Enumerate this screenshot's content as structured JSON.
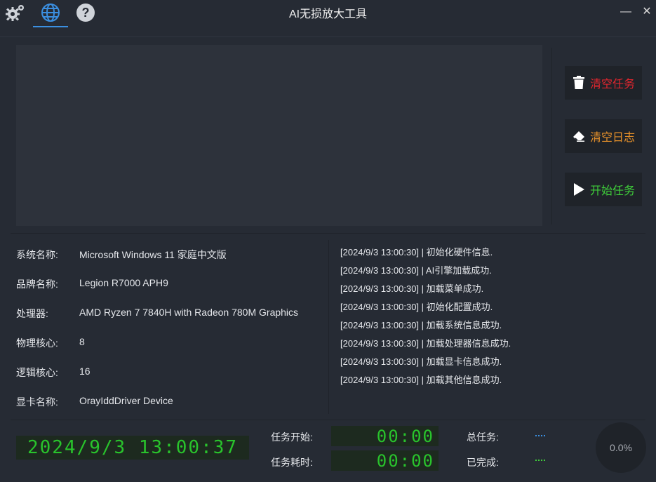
{
  "window": {
    "title": "AI无损放大工具",
    "icons": {
      "settings": "gear-icon",
      "language": "globe-icon",
      "help": "help-icon",
      "minimize": "minimize-icon",
      "close": "close-icon"
    },
    "active_tab_color": "#3b8fe0"
  },
  "actions": {
    "clear_tasks": "清空任务",
    "clear_log": "清空日志",
    "start_task": "开始任务",
    "colors": {
      "clear_tasks": "#e0262e",
      "clear_log": "#e8922a",
      "start_task": "#3fcf3a"
    }
  },
  "system_info": [
    {
      "label": "系统名称:",
      "value": "Microsoft Windows 11 家庭中文版"
    },
    {
      "label": "品牌名称:",
      "value": "Legion R7000 APH9"
    },
    {
      "label": "处理器:",
      "value": "AMD Ryzen 7 7840H with Radeon 780M Graphics"
    },
    {
      "label": "物理核心:",
      "value": "8"
    },
    {
      "label": "逻辑核心:",
      "value": "16"
    },
    {
      "label": "显卡名称:",
      "value": "OrayIddDriver Device"
    }
  ],
  "log": [
    "[2024/9/3 13:00:30] | 初始化硬件信息.",
    "[2024/9/3 13:00:30] | AI引擎加载成功.",
    "[2024/9/3 13:00:30] | 加载菜单成功.",
    "[2024/9/3 13:00:30] | 初始化配置成功.",
    "[2024/9/3 13:00:30] | 加载系统信息成功.",
    "[2024/9/3 13:00:30] | 加载处理器信息成功.",
    "[2024/9/3 13:00:30] | 加载显卡信息成功.",
    "[2024/9/3 13:00:30] | 加载其他信息成功."
  ],
  "status": {
    "clock": "2024/9/3 13:00:37",
    "task_start_label": "任务开始:",
    "task_start_value": "00:00",
    "task_elapsed_label": "任务耗时:",
    "task_elapsed_value": "00:00",
    "total_tasks_label": "总任务:",
    "completed_label": "已完成:",
    "progress": "0.0%"
  }
}
